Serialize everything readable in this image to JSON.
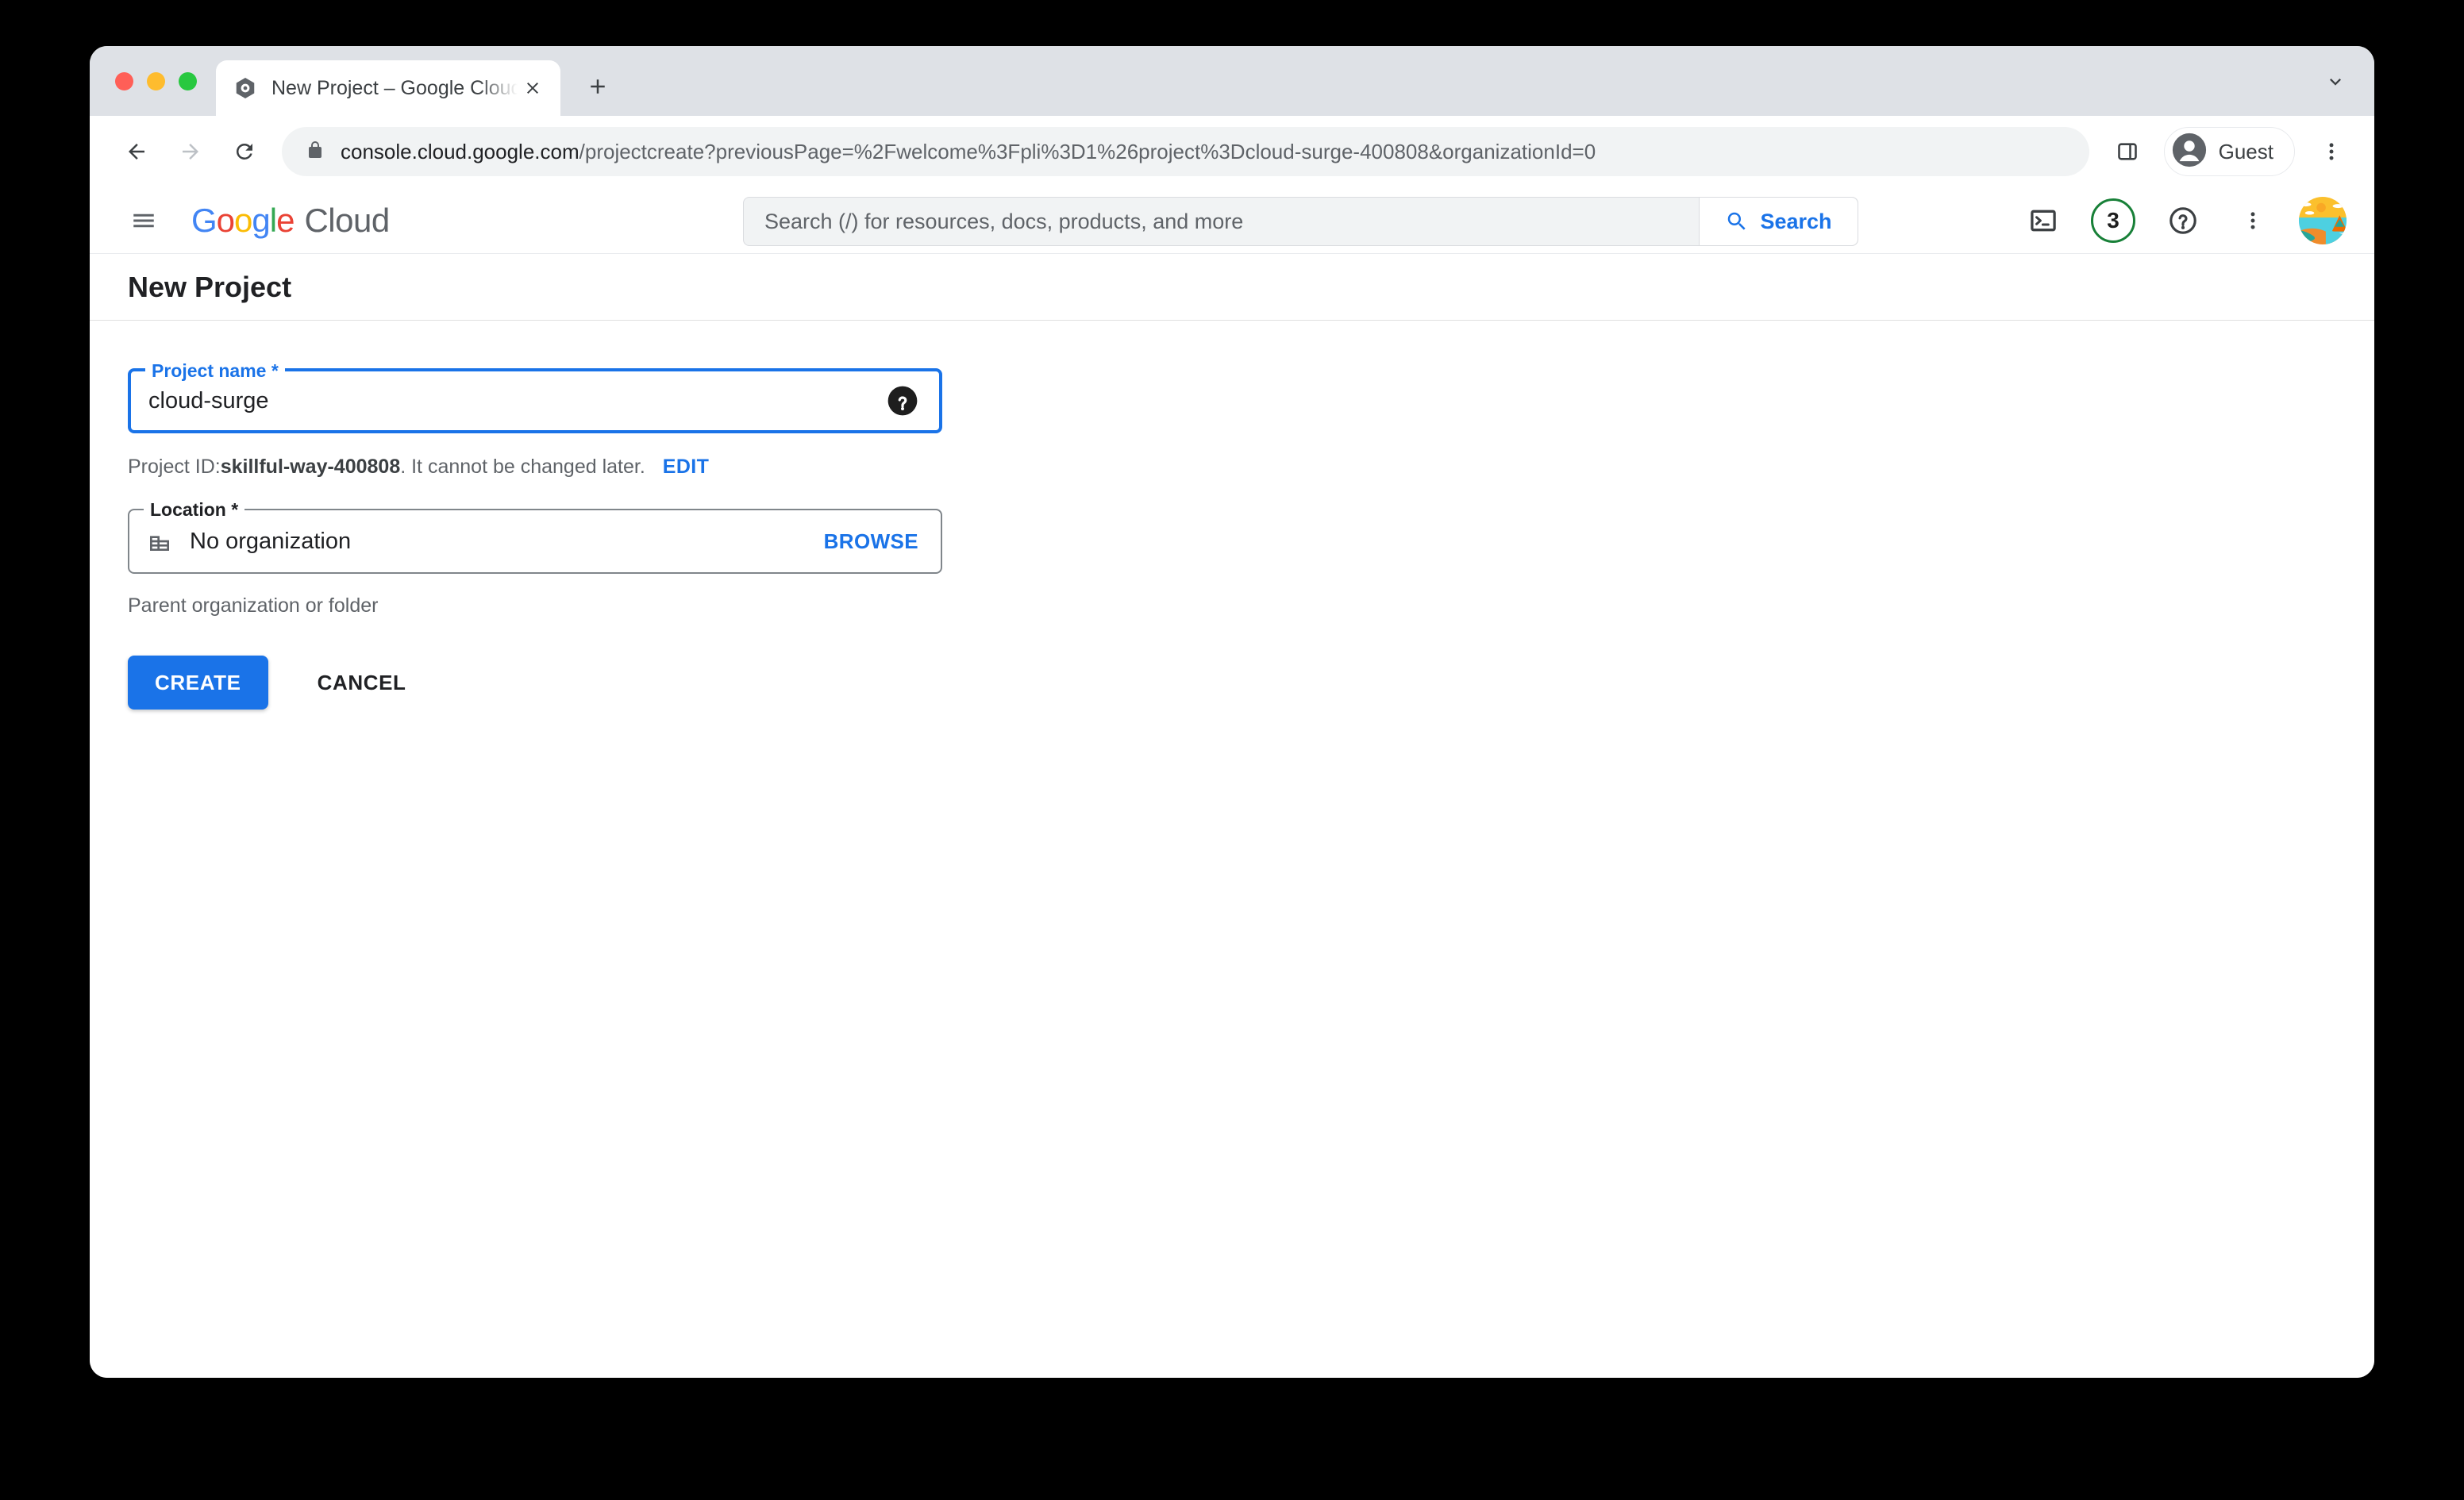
{
  "browser": {
    "tab": {
      "title": "New Project – Google Cloud co",
      "favicon_name": "google-cloud-favicon"
    },
    "new_tab_label": "+",
    "omnibox": {
      "host": "console.cloud.google.com",
      "path": "/projectcreate?previousPage=%2Fwelcome%3Fpli%3D1%26project%3Dcloud-surge-400808&organizationId=0",
      "lock_icon": "lock-icon"
    },
    "profile": {
      "label": "Guest"
    }
  },
  "gcp_header": {
    "logo_google": [
      {
        "ch": "G",
        "color": "#4285F4"
      },
      {
        "ch": "o",
        "color": "#EA4335"
      },
      {
        "ch": "o",
        "color": "#FBBC05"
      },
      {
        "ch": "g",
        "color": "#4285F4"
      },
      {
        "ch": "l",
        "color": "#34A853"
      },
      {
        "ch": "e",
        "color": "#EA4335"
      }
    ],
    "logo_cloud": "Cloud",
    "search": {
      "placeholder": "Search (/) for resources, docs, products, and more",
      "value": "",
      "button_label": "Search"
    },
    "credits_badge": "3",
    "icons": {
      "cloud_shell": "terminal-icon",
      "help": "help-circle-icon",
      "more": "more-vert-icon",
      "avatar": "user-avatar"
    }
  },
  "page": {
    "title": "New Project",
    "project_name": {
      "label": "Project name *",
      "value": "cloud-surge",
      "placeholder": "",
      "help_icon": "help-filled-icon"
    },
    "project_id": {
      "prefix": "Project ID: ",
      "value": "skillful-way-400808",
      "suffix": ". It cannot be changed later.",
      "edit_label": "EDIT"
    },
    "location": {
      "label": "Location *",
      "value": "No organization",
      "browse_label": "BROWSE",
      "hint": "Parent organization or folder",
      "icon": "organization-icon"
    },
    "actions": {
      "create_label": "CREATE",
      "cancel_label": "CANCEL"
    }
  },
  "colors": {
    "accent_blue": "#1a73e8",
    "green": "#188038",
    "chrome_gray": "#dee1e6",
    "text_primary": "#202124",
    "text_secondary": "#5f6368"
  }
}
